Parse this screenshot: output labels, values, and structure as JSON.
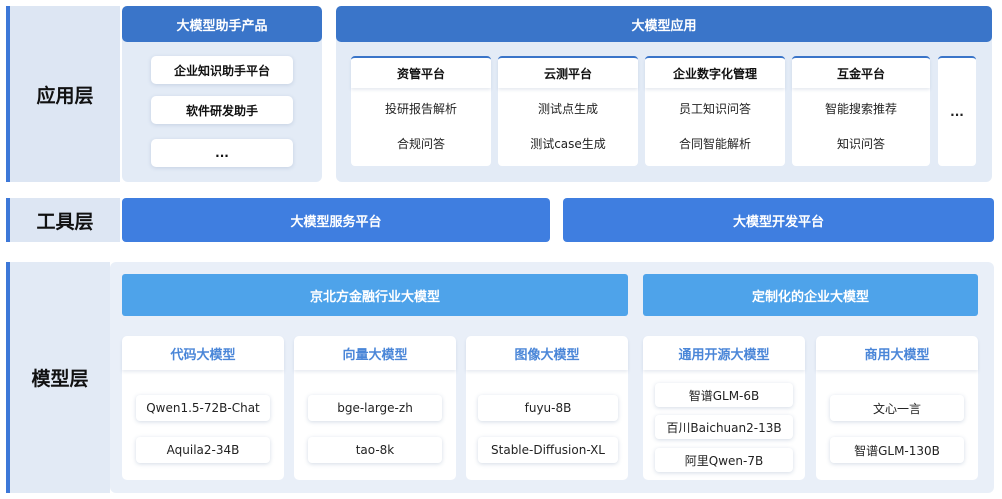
{
  "layers": {
    "app": "应用层",
    "tool": "工具层",
    "model": "模型层"
  },
  "assistant": {
    "title": "大模型助手产品",
    "items": [
      "企业知识助手平台",
      "软件研发助手",
      "..."
    ]
  },
  "application": {
    "title": "大模型应用",
    "columns": [
      {
        "title": "资管平台",
        "items": [
          "投研报告解析",
          "合规问答"
        ]
      },
      {
        "title": "云测平台",
        "items": [
          "测试点生成",
          "测试case生成"
        ]
      },
      {
        "title": "企业数字化管理",
        "items": [
          "员工知识问答",
          "合同智能解析"
        ]
      },
      {
        "title": "互金平台",
        "items": [
          "智能搜索推荐",
          "知识问答"
        ]
      }
    ],
    "more": "..."
  },
  "tools": {
    "service": "大模型服务平台",
    "dev": "大模型开发平台"
  },
  "models": {
    "industry": "京北方金融行业大模型",
    "custom": "定制化的企业大模型",
    "columns": [
      {
        "title": "代码大模型",
        "items": [
          "Qwen1.5-72B-Chat",
          "Aquila2-34B"
        ]
      },
      {
        "title": "向量大模型",
        "items": [
          "bge-large-zh",
          "tao-8k"
        ]
      },
      {
        "title": "图像大模型",
        "items": [
          "fuyu-8B",
          "Stable-Diffusion-XL"
        ]
      },
      {
        "title": "通用开源大模型",
        "items": [
          "智谱GLM-6B",
          "百川Baichuan2-13B",
          "阿里Qwen-7B"
        ]
      },
      {
        "title": "商用大模型",
        "items": [
          "文心一言",
          "智谱GLM-130B"
        ]
      }
    ]
  }
}
